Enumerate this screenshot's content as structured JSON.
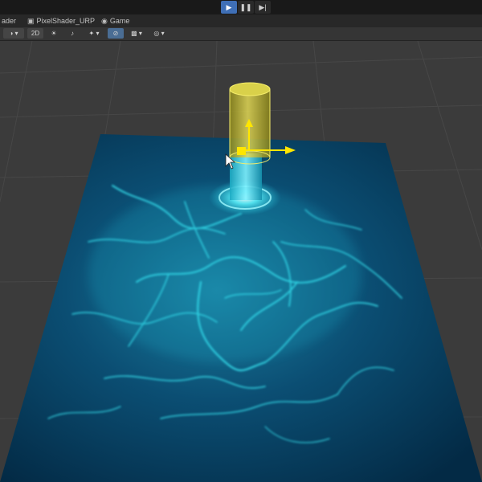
{
  "playmode": {
    "play_icon": "play-icon",
    "pause_icon": "pause-icon",
    "step_icon": "step-icon"
  },
  "tabs": [
    {
      "label": "ader",
      "icon": ""
    },
    {
      "label": "PixelShader_URP",
      "icon": "file-icon"
    },
    {
      "label": "Game",
      "icon": "game-controller-icon"
    }
  ],
  "scene_toolbar": {
    "draw_mode_icon": "shading-sphere-icon",
    "mode_2d_label": "2D",
    "lighting_icon": "lighting-icon",
    "audio_icon": "audio-icon",
    "effects_icon": "effects-icon",
    "visibility_icon": "scene-visibility-icon",
    "camera_icon": "camera-icon",
    "gizmos_icon": "gizmos-icon"
  },
  "scene": {
    "plane_color": "#052c48",
    "caustic_color": "#38e6f2",
    "cylinder_color": "#c9c13a",
    "gizmo_color": "#ffe600"
  }
}
